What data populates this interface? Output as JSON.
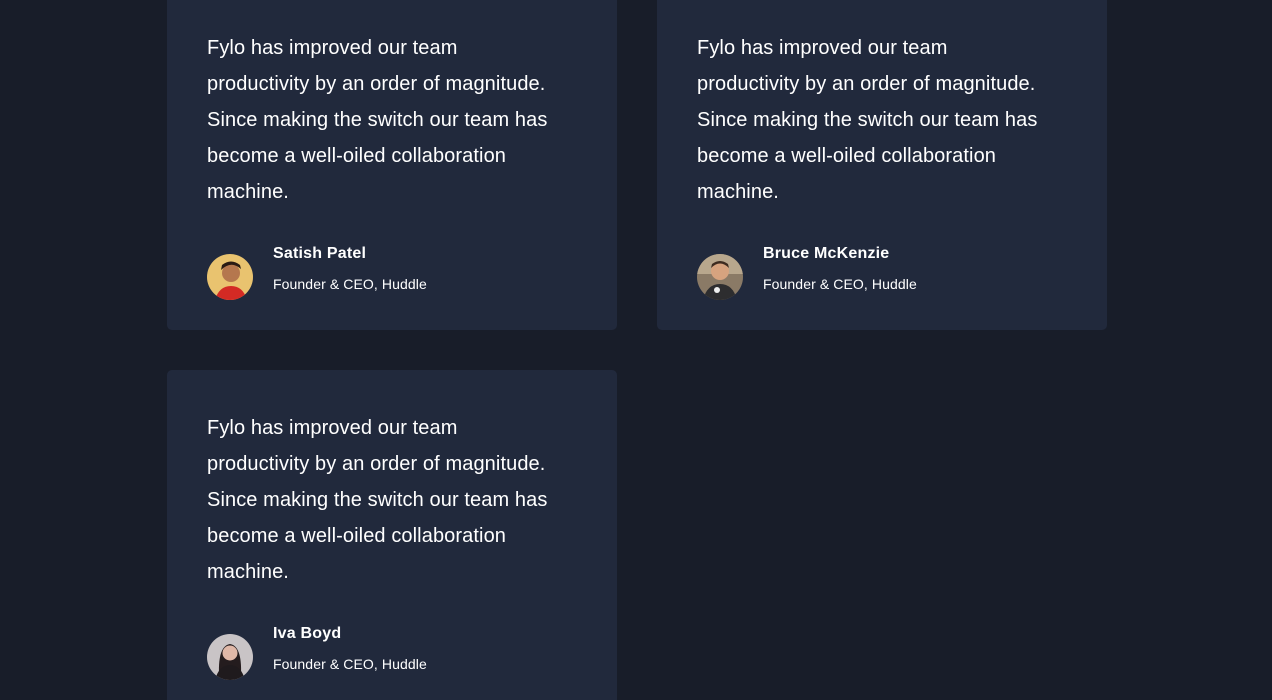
{
  "testimonials": [
    {
      "quote": "Fylo has improved our team productivity by an order of magnitude. Since making the switch our team has become a well-oiled collaboration machine.",
      "name": "Satish Patel",
      "role": "Founder & CEO, Huddle",
      "avatar_icon": "avatar-satish-patel"
    },
    {
      "quote": "Fylo has improved our team productivity by an order of magnitude. Since making the switch our team has become a well-oiled collaboration machine.",
      "name": "Bruce McKenzie",
      "role": "Founder & CEO, Huddle",
      "avatar_icon": "avatar-bruce-mckenzie"
    },
    {
      "quote": "Fylo has improved our team productivity by an order of magnitude. Since making the switch our team has become a well-oiled collaboration machine.",
      "name": "Iva Boyd",
      "role": "Founder & CEO, Huddle",
      "avatar_icon": "avatar-iva-boyd"
    }
  ],
  "colors": {
    "page_bg": "#181d29",
    "card_bg": "#21293c",
    "text": "#ffffff"
  }
}
